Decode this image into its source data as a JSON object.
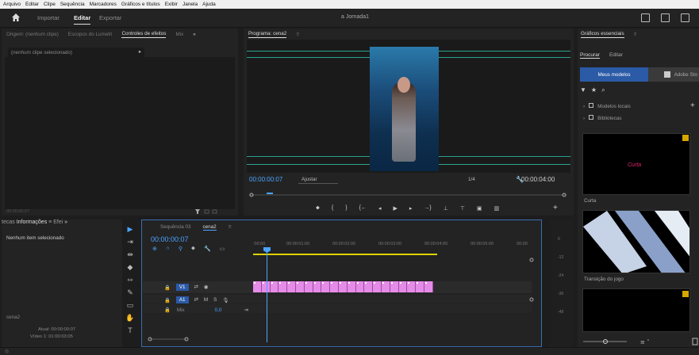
{
  "menu": [
    "Arquivo",
    "Editar",
    "Clipe",
    "Sequência",
    "Marcadores",
    "Gráficos e títulos",
    "Exibir",
    "Janela",
    "Ajuda"
  ],
  "workspaces": {
    "import": "Importar",
    "edit": "Editar",
    "export": "Exportar"
  },
  "doc_title": "a Jornada1",
  "source": {
    "tabs": [
      "Origem: (nenhum clipe)",
      "Escopos do Lumetri",
      "Controles de efeitos",
      "Mix"
    ],
    "active_tab": "Controles de efeitos",
    "dropdown": "(nenhum clipe selecionado)",
    "timecode": "00:00:00:07"
  },
  "program": {
    "tab": "Programa: cena2",
    "timecode": "00:00:00:07",
    "fit": "Ajustar",
    "ratio": "1/4",
    "duration": "00:00:04:00"
  },
  "essential_graphics": {
    "title": "Gráficos essenciais",
    "tabs": [
      "Procurar",
      "Editar"
    ],
    "active_tab": "Procurar",
    "seg_a": "Meus modelos",
    "seg_b": "Adobe Sto",
    "libs": [
      "Modelos locais",
      "Bibliotecas"
    ],
    "cards": [
      {
        "label": "Curta",
        "text": "Curta",
        "accent": "#e0246e"
      },
      {
        "label": "Transição do jogo"
      },
      {
        "label": ""
      }
    ]
  },
  "info": {
    "tabs": [
      "tecas",
      "Informações",
      "Efei"
    ],
    "active_tab": "Informações",
    "selected": "Nenhum item selecionado",
    "seq": "cena2",
    "current_label": "Atual: 00:00:00:07",
    "video_label": "Vídeo 1: 01:00:03:05"
  },
  "sequence": {
    "tabs": [
      "Sequência 03",
      "cena2"
    ],
    "active_tab": "cena2",
    "timecode": "00:00:00:07",
    "ruler": [
      ":00:00",
      "00:00:01:00",
      "00:00:02:00",
      "00:00:03:00",
      "00:00:04:00",
      "00:00:05:00",
      "00:00"
    ],
    "tracks": {
      "v1": "V1",
      "a1": "A1",
      "mix": "Mix",
      "mix_val": "0,0",
      "m": "M",
      "s": "S"
    },
    "clip_count": 21,
    "clip_color": "#e58be8"
  },
  "meter_labels": [
    "0",
    "-12",
    "-24",
    "-36",
    "-48"
  ],
  "colors": {
    "accent": "#4aa3ff",
    "timeline_yellow": "#e0d200",
    "guide": "#2aa38d"
  }
}
